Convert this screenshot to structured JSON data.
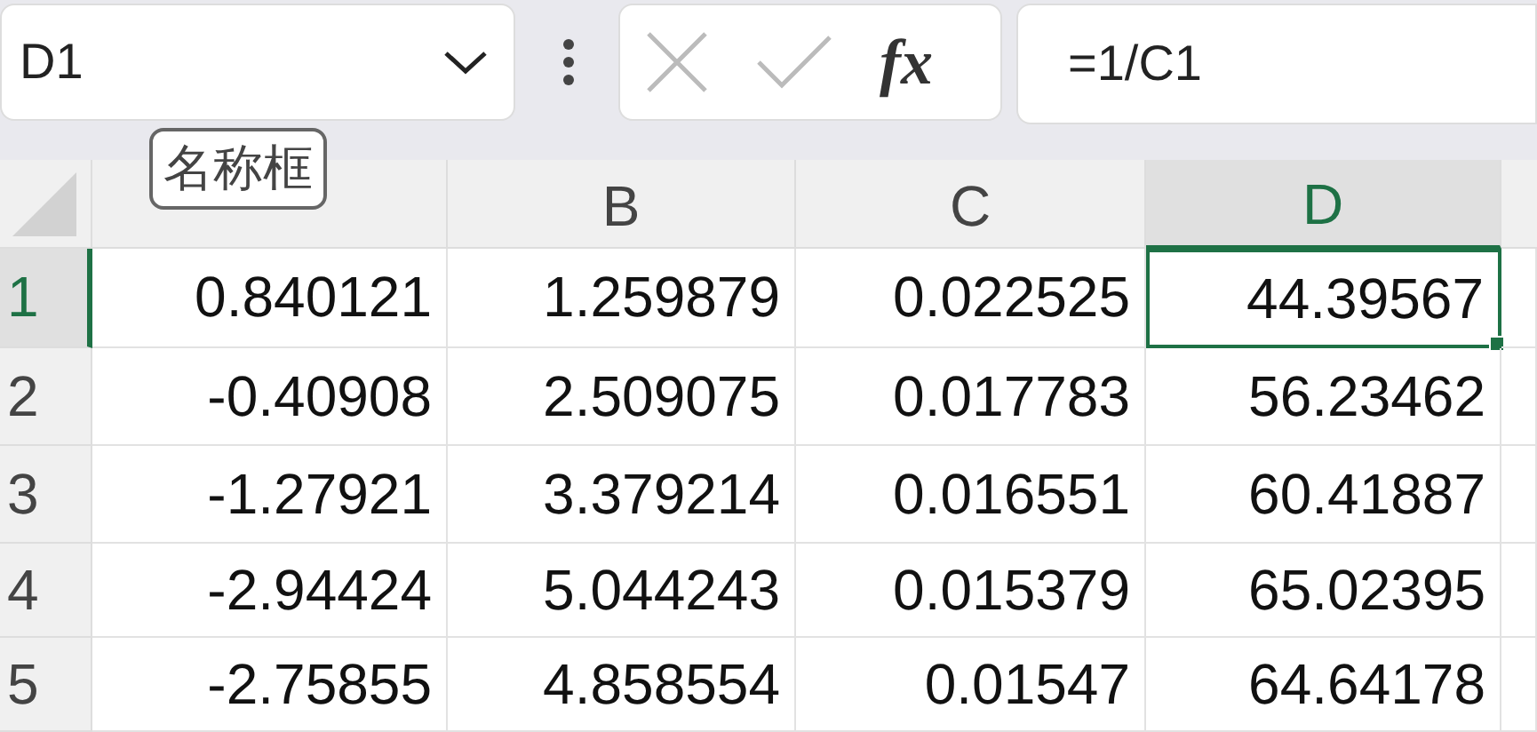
{
  "name_box": {
    "value": "D1"
  },
  "formula_bar": {
    "function_label": "fx",
    "formula": "=1/C1"
  },
  "tooltip": "名称框",
  "columns": [
    {
      "selected": false
    },
    {
      "label": "B",
      "selected": false
    },
    {
      "label": "C",
      "selected": false
    },
    {
      "label": "D",
      "selected": true
    }
  ],
  "rows": [
    {
      "label": "1",
      "selected": true,
      "cells": [
        {
          "value": "0.840121",
          "selected": false
        },
        {
          "value": "1.259879",
          "selected": false
        },
        {
          "value": "0.022525",
          "selected": false
        },
        {
          "value": "44.39567",
          "selected": true
        }
      ]
    },
    {
      "label": "2",
      "selected": false,
      "cells": [
        {
          "value": "-0.40908",
          "selected": false
        },
        {
          "value": "2.509075",
          "selected": false
        },
        {
          "value": "0.017783",
          "selected": false
        },
        {
          "value": "56.23462",
          "selected": false
        }
      ]
    },
    {
      "label": "3",
      "selected": false,
      "cells": [
        {
          "value": "-1.27921",
          "selected": false
        },
        {
          "value": "3.379214",
          "selected": false
        },
        {
          "value": "0.016551",
          "selected": false
        },
        {
          "value": "60.41887",
          "selected": false
        }
      ]
    },
    {
      "label": "4",
      "selected": false,
      "cells": [
        {
          "value": "-2.94424",
          "selected": false
        },
        {
          "value": "5.044243",
          "selected": false
        },
        {
          "value": "0.015379",
          "selected": false
        },
        {
          "value": "65.02395",
          "selected": false
        }
      ]
    },
    {
      "label": "5",
      "selected": false,
      "cells": [
        {
          "value": "-2.75855",
          "selected": false
        },
        {
          "value": "4.858554",
          "selected": false
        },
        {
          "value": "0.01547",
          "selected": false
        },
        {
          "value": "64.64178",
          "selected": false
        }
      ]
    }
  ]
}
